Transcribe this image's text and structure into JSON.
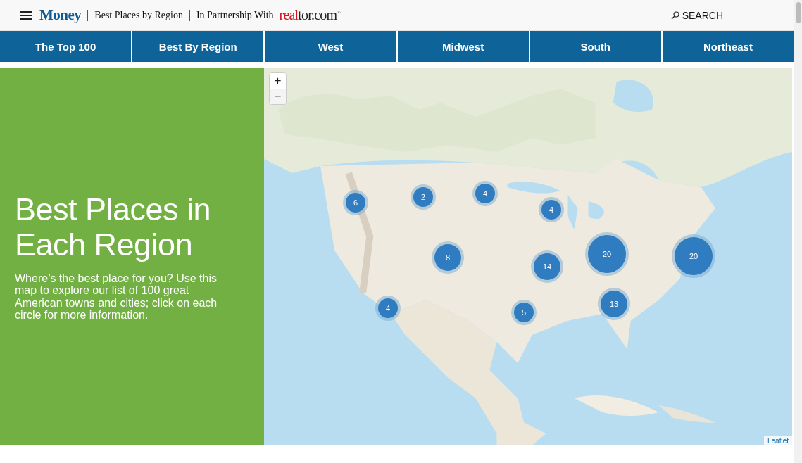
{
  "header": {
    "brand": "Money",
    "section": "Best Places by Region",
    "partner_label": "In Partnership With",
    "partner_logo": {
      "accent": "real",
      "rest": "tor.com",
      "mark": "®"
    },
    "search": "SEARCH"
  },
  "tabs": [
    {
      "label": "The Top 100",
      "selected": false
    },
    {
      "label": "Best By Region",
      "selected": false
    },
    {
      "label": "West",
      "selected": false
    },
    {
      "label": "Midwest",
      "selected": false
    },
    {
      "label": "South",
      "selected": false
    },
    {
      "label": "Northeast",
      "selected": false
    }
  ],
  "intro": {
    "title": "Best Places in Each Region",
    "text": "Where’s the best place for you? Use this map to explore our list of 100 great American towns and cities; click on each circle for more information."
  },
  "map": {
    "zoom_in": "+",
    "zoom_out": "−",
    "attribution": "Leaflet",
    "clusters": [
      {
        "count": "6",
        "kind": "small"
      },
      {
        "count": "2",
        "kind": "small"
      },
      {
        "count": "4",
        "kind": "small"
      },
      {
        "count": "4",
        "kind": "small"
      },
      {
        "count": "8",
        "kind": "medium"
      },
      {
        "count": "14",
        "kind": "medium"
      },
      {
        "count": "20",
        "kind": "large"
      },
      {
        "count": "20",
        "kind": "large"
      },
      {
        "count": "4",
        "kind": "small"
      },
      {
        "count": "5",
        "kind": "small"
      },
      {
        "count": "13",
        "kind": "medium"
      }
    ]
  }
}
